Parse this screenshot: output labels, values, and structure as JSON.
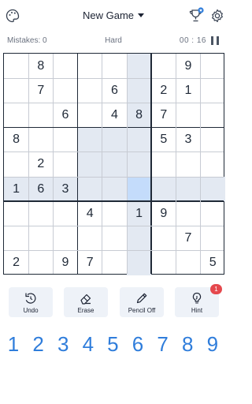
{
  "header": {
    "title": "New Game",
    "title_caret": "chevron-down-icon",
    "icons": [
      "palette-icon",
      "trophy-icon",
      "gear-icon"
    ]
  },
  "status": {
    "mistakes": "Mistakes: 0",
    "difficulty": "Hard",
    "timer": "00 : 16",
    "pause_icon": "pause-icon"
  },
  "board": {
    "selected": {
      "row": 5,
      "col": 5
    },
    "colors": {
      "highlight": "#e3e9f2",
      "selected": "#c4dcfb",
      "given": "#1f2937"
    },
    "grid": [
      [
        "",
        "8",
        "",
        "",
        "",
        "",
        "",
        "9",
        ""
      ],
      [
        "",
        "7",
        "",
        "",
        "6",
        "",
        "2",
        "1",
        ""
      ],
      [
        "",
        "",
        "6",
        "",
        "4",
        "8",
        "7",
        "",
        ""
      ],
      [
        "8",
        "",
        "",
        "",
        "",
        "",
        "5",
        "3",
        ""
      ],
      [
        "",
        "2",
        "",
        "",
        "",
        "",
        "",
        "",
        ""
      ],
      [
        "1",
        "6",
        "3",
        "",
        "",
        "",
        "",
        "",
        ""
      ],
      [
        "",
        "",
        "",
        "4",
        "",
        "1",
        "9",
        "",
        ""
      ],
      [
        "",
        "",
        "",
        "",
        "",
        "",
        "",
        "7",
        ""
      ],
      [
        "2",
        "",
        "9",
        "7",
        "",
        "",
        "",
        "",
        "5"
      ]
    ]
  },
  "tools": [
    {
      "label": "Undo",
      "icon": "undo-icon"
    },
    {
      "label": "Erase",
      "icon": "eraser-icon"
    },
    {
      "label": "Pencil Off",
      "icon": "pencil-icon"
    },
    {
      "label": "Hint",
      "icon": "lightbulb-icon",
      "badge": "1"
    }
  ],
  "numpad": [
    "1",
    "2",
    "3",
    "4",
    "5",
    "6",
    "7",
    "8",
    "9"
  ],
  "accent": "#2f7ddb"
}
